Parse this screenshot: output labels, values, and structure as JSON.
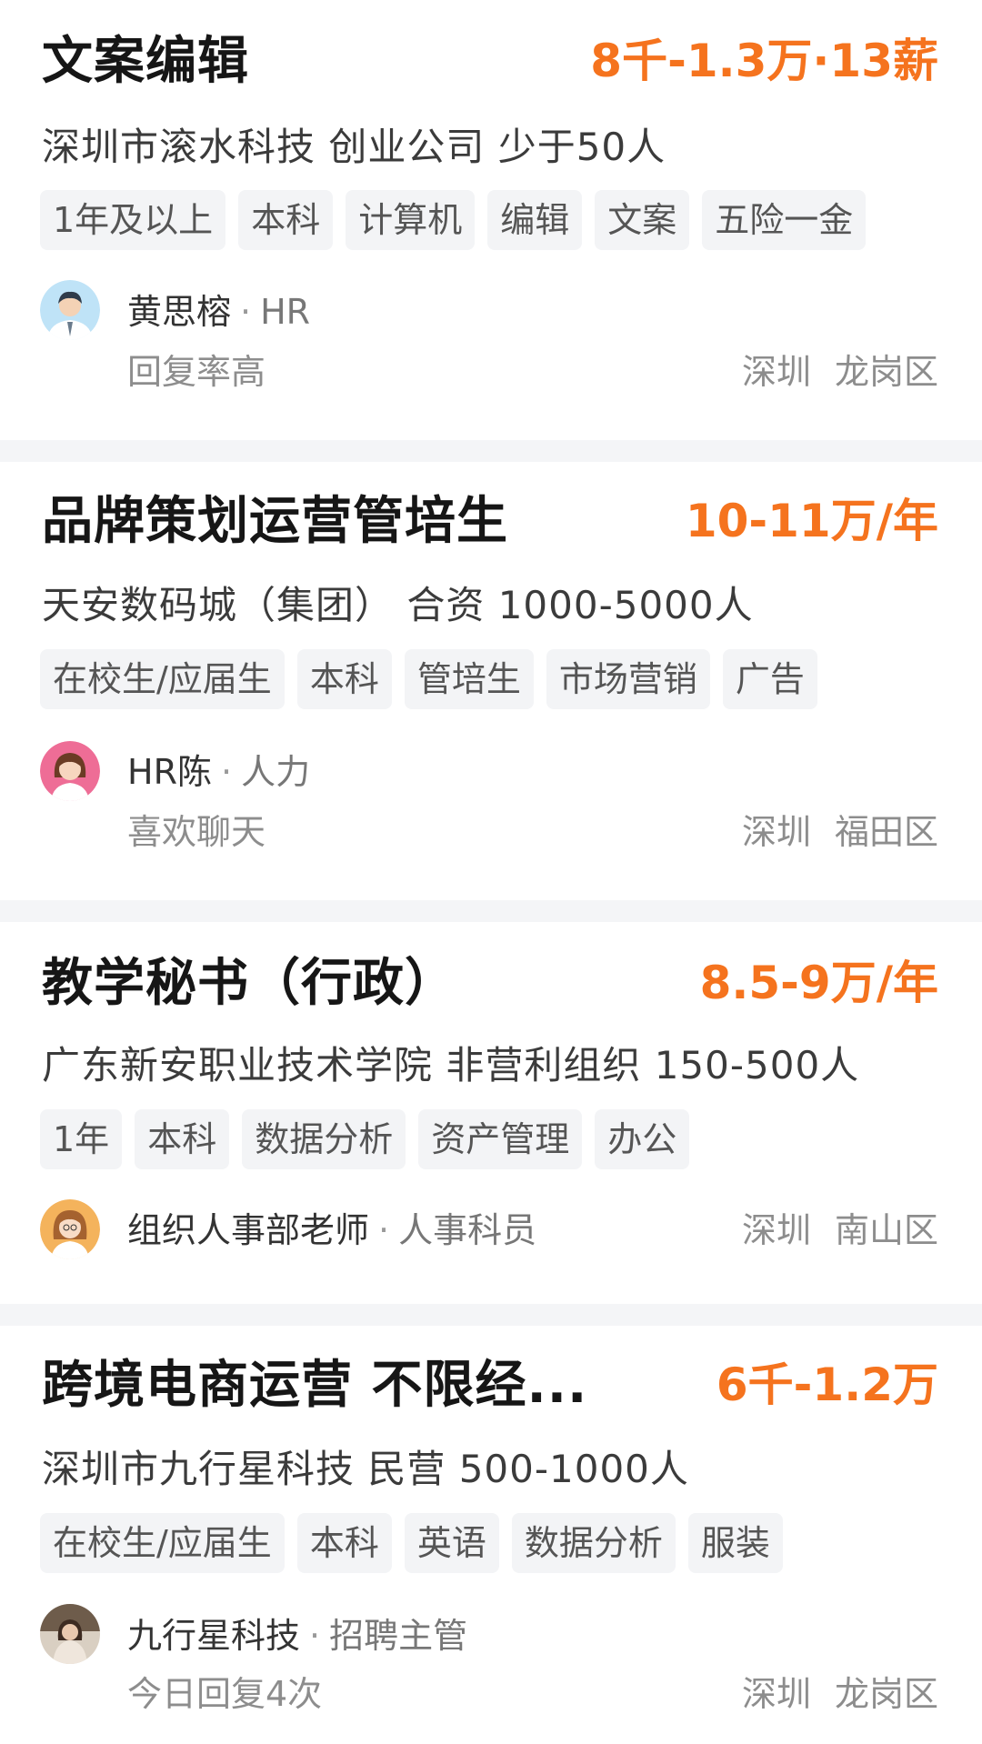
{
  "jobs": [
    {
      "title": "文案编辑",
      "salary": "8千-1.3万·13薪",
      "company": "深圳市滚水科技  创业公司  少于50人",
      "tags": [
        "1年及以上",
        "本科",
        "计算机",
        "编辑",
        "文案",
        "五险一金"
      ],
      "hr_name": "黄思榕",
      "hr_role": "HR",
      "hr_note": "回复率高",
      "city": "深圳",
      "district": "龙岗区",
      "avatar_icon": "male-hr-avatar-icon"
    },
    {
      "title": "品牌策划运营管培生",
      "salary": "10-11万/年",
      "company": "天安数码城（集团）  合资  1000-5000人",
      "tags": [
        "在校生/应届生",
        "本科",
        "管培生",
        "市场营销",
        "广告"
      ],
      "hr_name": "HR陈",
      "hr_role": "人力",
      "hr_note": "喜欢聊天",
      "city": "深圳",
      "district": "福田区",
      "avatar_icon": "female-hr-avatar-icon"
    },
    {
      "title": "教学秘书（行政）",
      "salary": "8.5-9万/年",
      "company": "广东新安职业技术学院  非营利组织  150-500人",
      "tags": [
        "1年",
        "本科",
        "数据分析",
        "资产管理",
        "办公"
      ],
      "hr_name": "组织人事部老师",
      "hr_role": "人事科员",
      "hr_note": "",
      "city": "深圳",
      "district": "南山区",
      "avatar_icon": "female-teacher-avatar-icon"
    },
    {
      "title": "跨境电商运营 不限经...",
      "salary": "6千-1.2万",
      "company": "深圳市九行星科技  民营  500-1000人",
      "tags": [
        "在校生/应届生",
        "本科",
        "英语",
        "数据分析",
        "服装"
      ],
      "hr_name": "九行星科技",
      "hr_role": "招聘主管",
      "hr_note": "今日回复4次",
      "city": "深圳",
      "district": "龙岗区",
      "avatar_icon": "photo-avatar-icon"
    }
  ]
}
